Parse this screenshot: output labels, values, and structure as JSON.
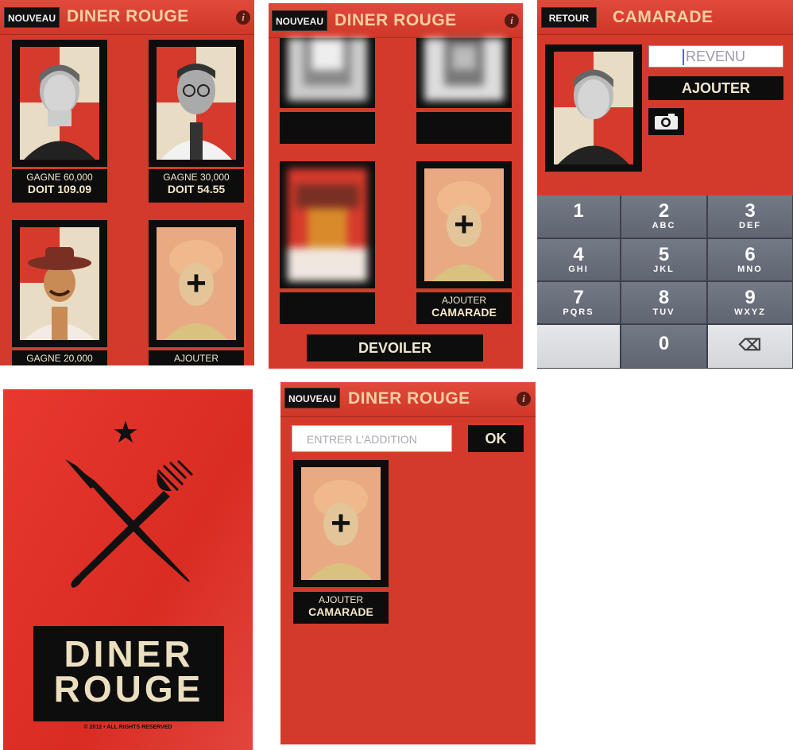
{
  "app": {
    "title": "DINER ROUGE",
    "nouveau": "NOUVEAU",
    "info": "i"
  },
  "screen1": {
    "cards": [
      {
        "line1": "GAGNE 60,000",
        "line2": "DOIT 109.09"
      },
      {
        "line1": "GAGNE 30,000",
        "line2": "DOIT 54.55"
      },
      {
        "line1": "GAGNE 20,000",
        "line2": ""
      },
      {
        "line1": "AJOUTER",
        "line2": ""
      }
    ],
    "plus": "+"
  },
  "screen2": {
    "add_line1": "AJOUTER",
    "add_line2": "CAMARADE",
    "reveal": "DEVOILER",
    "plus": "+"
  },
  "screen3": {
    "back": "RETOUR",
    "title": "CAMARADE",
    "income_placeholder": "REVENU",
    "add": "AJOUTER",
    "keys": [
      {
        "d": "1",
        "s": ""
      },
      {
        "d": "2",
        "s": "ABC"
      },
      {
        "d": "3",
        "s": "DEF"
      },
      {
        "d": "4",
        "s": "GHI"
      },
      {
        "d": "5",
        "s": "JKL"
      },
      {
        "d": "6",
        "s": "MNO"
      },
      {
        "d": "7",
        "s": "PQRS"
      },
      {
        "d": "8",
        "s": "TUV"
      },
      {
        "d": "9",
        "s": "WXYZ"
      },
      {
        "d": "",
        "s": ""
      },
      {
        "d": "0",
        "s": ""
      },
      {
        "d": "⌫",
        "s": ""
      }
    ]
  },
  "splash": {
    "star": "★",
    "logo_line1": "DINER",
    "logo_line2": "ROUGE",
    "copyright": "© 2012 • ALL RIGHTS RESERVED"
  },
  "screen5": {
    "bill_placeholder": "ENTRER L'ADDITION",
    "ok": "OK",
    "add_line1": "AJOUTER",
    "add_line2": "CAMARADE",
    "plus": "+"
  },
  "colors": {
    "red": "#d33a2c",
    "black": "#0d0d0d",
    "cream": "#f3cfa0"
  }
}
